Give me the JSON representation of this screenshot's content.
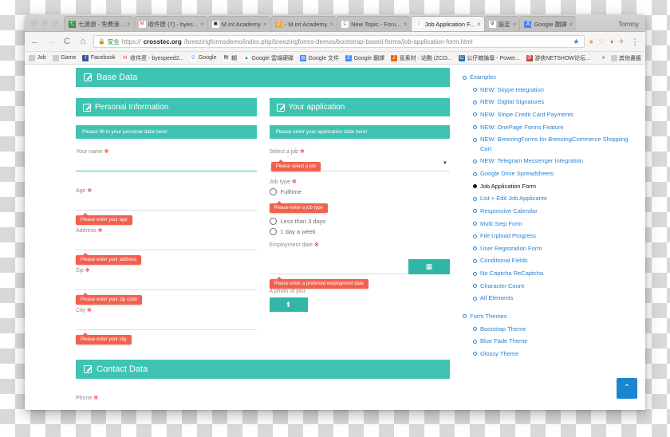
{
  "browser": {
    "profile_name": "Tommy",
    "tabs": [
      {
        "title": "七源源 - 免費港...",
        "favicon": "site-icon",
        "glyph": "七",
        "color": "#3a8f4a",
        "active": false
      },
      {
        "title": "收件匣 (7) - byes...",
        "favicon": "gmail-icon",
        "glyph": "M",
        "color": "#ffffff",
        "fg": "#d93025",
        "active": false
      },
      {
        "title": "M.int Academy",
        "favicon": "square-icon",
        "glyph": "▣",
        "color": "#ffffff",
        "fg": "#222222",
        "active": false
      },
      {
        "title": "- M.int Academy",
        "favicon": "joomla-icon",
        "glyph": "J",
        "color": "#f4a93c",
        "active": false
      },
      {
        "title": "New Topic - Foru...",
        "favicon": "crosstec-icon",
        "glyph": "C",
        "color": "#ffffff",
        "fg": "#2a83d4",
        "active": false
      },
      {
        "title": "Job Application F...",
        "favicon": "page-icon",
        "glyph": "▯",
        "color": "#ffffff",
        "fg": "#999999",
        "active": true
      },
      {
        "title": "設定",
        "favicon": "gear-icon",
        "glyph": "⚙",
        "color": "#ffffff",
        "fg": "#444444",
        "active": false
      },
      {
        "title": "Google 翻譯",
        "favicon": "translate-icon",
        "glyph": "文",
        "color": "#4285f4",
        "active": false
      }
    ],
    "toolbar": {
      "back_label": "←",
      "forward_label": "→",
      "reload_label": "C",
      "home_label": "⌂",
      "lock_icon": "lock-icon",
      "secure_label": "安全",
      "url_scheme": "https://",
      "url_host": "crosstec.org",
      "url_path": "/breezingformsdemo/index.php/breezingforms-demos/bootstrap-based-forms/job-application-form.html",
      "star_label": "★",
      "ext1_label": "●",
      "ext2_label": "♡",
      "ext3_label": "◖",
      "ext4_label": "✈",
      "menu_label": "⋮"
    },
    "bookmarks": [
      {
        "label": "Job",
        "icon": "folder-icon",
        "glyph": "",
        "color": "#cfcdcb"
      },
      {
        "label": "Game",
        "icon": "folder-icon",
        "glyph": "",
        "color": "#cfcdcb"
      },
      {
        "label": "Facebook",
        "icon": "facebook-icon",
        "glyph": "f",
        "color": "#3b5998"
      },
      {
        "label": "收件匣 - byespeed2...",
        "icon": "gmail-icon",
        "glyph": "M",
        "color": "#ffffff",
        "fg": "#d93025"
      },
      {
        "label": "Google",
        "icon": "google-icon",
        "glyph": "G",
        "color": "#ffffff",
        "fg": "#4285f4"
      },
      {
        "label": "糊",
        "icon": "site-icon",
        "glyph": "糊",
        "color": "#ffffff",
        "fg": "#333333"
      },
      {
        "label": "Google 雲端硬碟",
        "icon": "drive-icon",
        "glyph": "▲",
        "color": "#ffffff",
        "fg": "#1aa260"
      },
      {
        "label": "Google 文件",
        "icon": "docs-icon",
        "glyph": "▤",
        "color": "#4285f4"
      },
      {
        "label": "Google 翻譯",
        "icon": "translate-icon",
        "glyph": "文",
        "color": "#4285f4"
      },
      {
        "label": "覓素材 - 站酷 (ZCO...",
        "icon": "zcool-icon",
        "glyph": "Z",
        "color": "#ff5c00"
      },
      {
        "label": "公仔箱論壇 - Power...",
        "icon": "forum-icon",
        "glyph": "公",
        "color": "#2a6ebb"
      },
      {
        "label": "游俠NETSHOW论坛...",
        "icon": "netshow-icon",
        "glyph": "游",
        "color": "#c0392b"
      }
    ],
    "bookmarks_overflow_label": "»",
    "other_bookmarks_label": "其他書籤",
    "other_bookmarks_icon": "folder-icon"
  },
  "form": {
    "base_header": "Base Data",
    "personal": {
      "header": "Personal Information",
      "hint": "Please fill in your personal data here!",
      "fields": [
        {
          "label": "Your name",
          "required_mark": "✻",
          "error": null,
          "focused": true
        },
        {
          "label": "Age",
          "required_mark": "✻",
          "error": "Please enter your age",
          "focused": false
        },
        {
          "label": "Address",
          "required_mark": "✻",
          "error": "Please enter your address",
          "focused": false
        },
        {
          "label": "Zip",
          "required_mark": "✻",
          "error": "Please enter your zip code",
          "focused": false
        },
        {
          "label": "City",
          "required_mark": "✻",
          "error": "Please enter your city",
          "focused": false
        }
      ]
    },
    "application": {
      "header": "Your application",
      "hint": "Please enter your application data here!",
      "select_job": {
        "label": "Select a job",
        "required_mark": "✻",
        "error": "Please select a job",
        "value": "",
        "caret": "▼"
      },
      "job_type": {
        "label": "Job type",
        "required_mark": "✻",
        "error": "Please enter a job type",
        "options": [
          "Fulltime",
          "Less than 3 days",
          "1 day a week"
        ],
        "selected": null
      },
      "employment_date": {
        "label": "Employment date",
        "required_mark": "✻",
        "error": "Please enter a preferred employment date",
        "value": "",
        "calendar_icon": "calendar-icon",
        "calendar_glyph": "▦"
      },
      "photo": {
        "label": "A photo of you",
        "upload_icon": "upload-icon",
        "upload_glyph": "⬆"
      }
    },
    "contact": {
      "header": "Contact Data",
      "phone_label": "Phone",
      "phone_required_mark": "✻"
    }
  },
  "sidebar": {
    "groups": [
      {
        "title": "Examples",
        "level": 1,
        "items": [
          "NEW: Skype Integration",
          "NEW: Digital Signatures",
          "NEW: Stripe Credit Card Payments",
          "NEW: OnePage Forms Feature",
          "NEW: BreezingForms for BreezingCommerce Shopping Cart",
          "NEW: Telegram Messenger Integration",
          "Google Drive Spreadsheets",
          "Job Application Form",
          "List + Edit Job Applicants",
          "Responsive Calendar",
          "Multi Step Form",
          "File Upload Progress",
          "User Registration Form",
          "Conditional Fields",
          "No Captcha ReCaptcha",
          "Character Count",
          "All Elements"
        ],
        "current": "Job Application Form"
      },
      {
        "title": "Form Themes",
        "level": 1,
        "items": [
          "Bootstrap Theme",
          "Blue Fade Theme",
          "Glossy Theme"
        ],
        "current": null
      }
    ],
    "scroll_top_label": "⌃",
    "scroll_top_icon": "chevron-up-icon"
  },
  "colors": {
    "teal": "#3fc4b3",
    "teal_dark": "#2fb6a6",
    "error_red": "#f4604e",
    "link_blue": "#2a83d4",
    "button_blue": "#1a85d0",
    "required_red": "#e8392b"
  }
}
